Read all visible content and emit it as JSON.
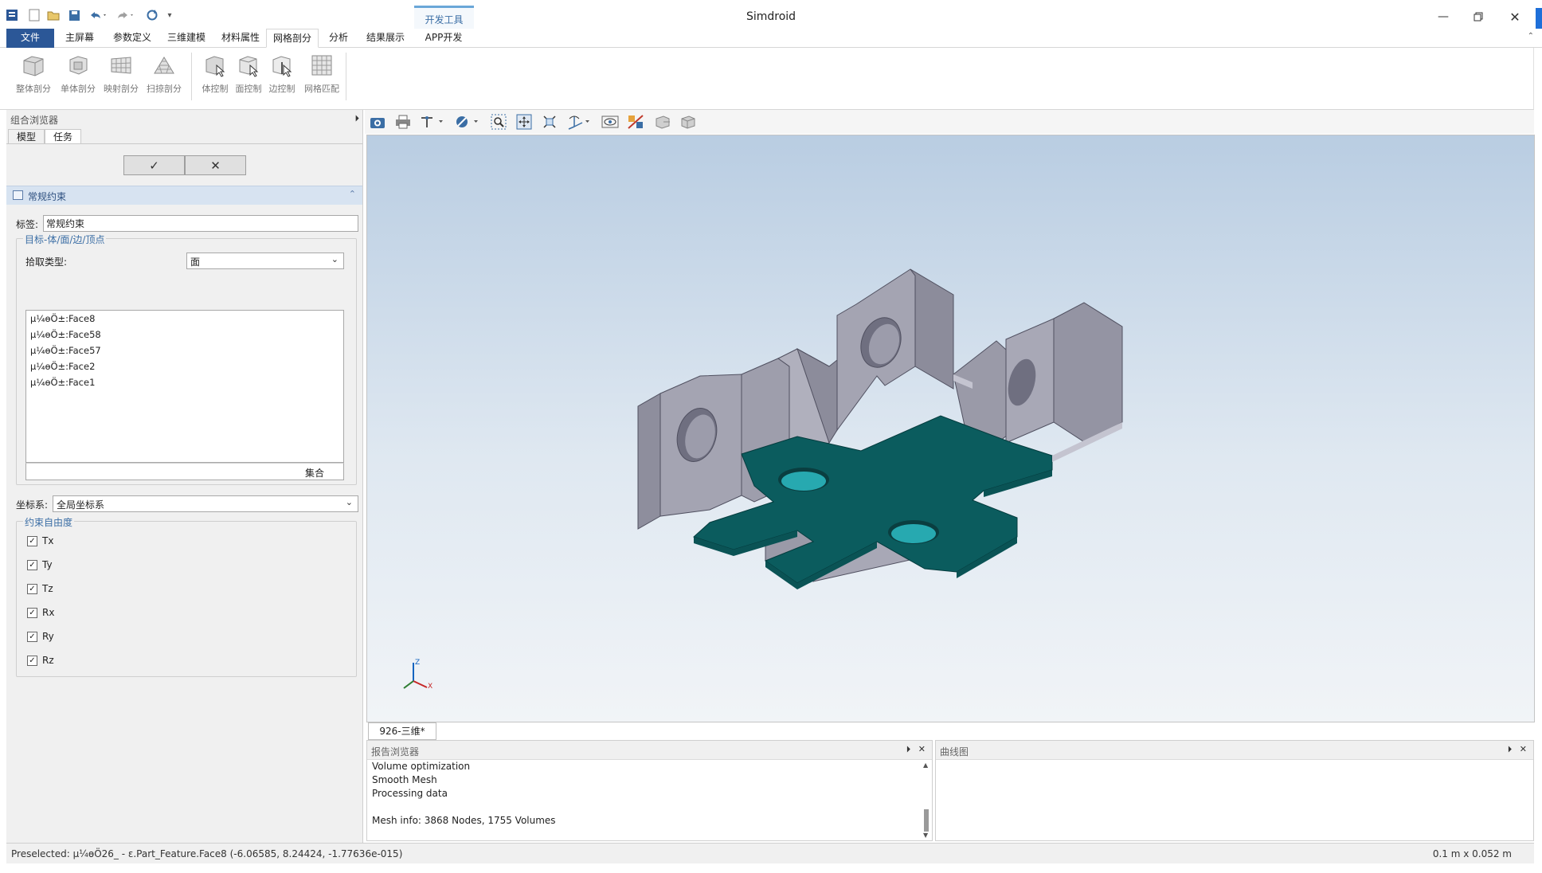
{
  "app": {
    "title": "Simdroid",
    "context_tab_label": "开发工具"
  },
  "quick_access": [
    "app-menu-icon",
    "new-icon",
    "open-icon",
    "save-icon",
    "undo-icon",
    "redo-icon",
    "refresh-icon",
    "customize-icon"
  ],
  "ribbon_tabs": [
    {
      "label": "文件",
      "file": true
    },
    {
      "label": "主屏幕"
    },
    {
      "label": "参数定义"
    },
    {
      "label": "三维建模"
    },
    {
      "label": "材料属性"
    },
    {
      "label": "网格剖分",
      "active": true
    },
    {
      "label": "分析"
    },
    {
      "label": "结果展示"
    },
    {
      "label": "APP开发器"
    }
  ],
  "ribbon": {
    "mesh_buttons": [
      "整体剖分",
      "单体剖分",
      "映射剖分",
      "扫掠剖分"
    ],
    "control_buttons": [
      "体控制",
      "面控制",
      "边控制",
      "网格匹配"
    ]
  },
  "left_panel": {
    "title": "组合浏览器",
    "tabs": [
      "模型",
      "任务"
    ],
    "ok_symbol": "✓",
    "cancel_symbol": "✕",
    "section_title": "常规约束",
    "label_caption": "标签:",
    "label_value": "常规约束",
    "target_group_title": "目标-体/面/边/顶点",
    "pick_type_caption": "拾取类型:",
    "pick_type_value": "面",
    "faces": [
      "µ¼ѳÖ±:Face8",
      "µ¼ѳÖ±:Face58",
      "µ¼ѳÖ±:Face57",
      "µ¼ѳÖ±:Face2",
      "µ¼ѳÖ±:Face1"
    ],
    "set_label": "集合",
    "coord_caption": "坐标系:",
    "coord_value": "全局坐标系",
    "dof_group_title": "约束自由度",
    "dofs": [
      {
        "label": "Tx",
        "checked": true
      },
      {
        "label": "Ty",
        "checked": true
      },
      {
        "label": "Tz",
        "checked": true
      },
      {
        "label": "Rx",
        "checked": true
      },
      {
        "label": "Ry",
        "checked": true
      },
      {
        "label": "Rz",
        "checked": true
      }
    ]
  },
  "viewport": {
    "tab_label": "926-三维*",
    "axis_labels": {
      "z": "Z",
      "x": "X"
    },
    "colors": {
      "model_side": "#9d9dab",
      "model_highlight": "#0b5c5e",
      "hole": "#27a9b0"
    }
  },
  "report": {
    "title": "报告浏览器",
    "lines": [
      "Volume optimization",
      "Smooth Mesh",
      "Processing data",
      "",
      "Mesh info: 3868 Nodes, 1755 Volumes"
    ]
  },
  "curve_panel": {
    "title": "曲线图"
  },
  "status": {
    "preselected": "Preselected: µ¼ѳÖ26_ - ε.Part_Feature.Face8 (-6.06585, 8.24424, -1.77636e-015)",
    "dimension": "0.1 m x 0.052 m"
  }
}
